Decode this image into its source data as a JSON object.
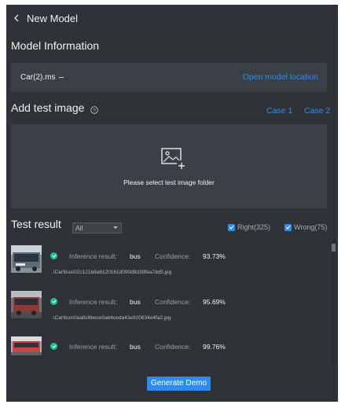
{
  "header": {
    "title": "New Model"
  },
  "model_info": {
    "heading": "Model Information",
    "model_name": "Car(2).ms",
    "open_location_link": "Open model location"
  },
  "test_image": {
    "heading": "Add test image",
    "case1": "Case 1",
    "case2": "Case 2",
    "drop_text": "Please select test image folder"
  },
  "test_result": {
    "heading": "Test result",
    "filter_value": "All",
    "right_label": "Right(325)",
    "wrong_label": "Wrong(75)",
    "inference_label": "Inference result:",
    "confidence_label": "Confidence:",
    "rows": [
      {
        "result": "bus",
        "confidence": "93.73%",
        "path": ".\\Car\\bus\\02c121b8a6120161d090d9d38fea7dd5.jpg"
      },
      {
        "result": "bus",
        "confidence": "95.69%",
        "path": ".\\Car\\bus\\0aa8c6bece0ab6ceda43e920634e4fa2.jpg"
      },
      {
        "result": "bus",
        "confidence": "99.76%",
        "path": ""
      }
    ]
  },
  "footer": {
    "generate_label": "Generate Demo"
  },
  "colors": {
    "background": "#2f3338",
    "box": "#3b4046",
    "accent": "#2d8cf0",
    "success": "#19be9b"
  }
}
